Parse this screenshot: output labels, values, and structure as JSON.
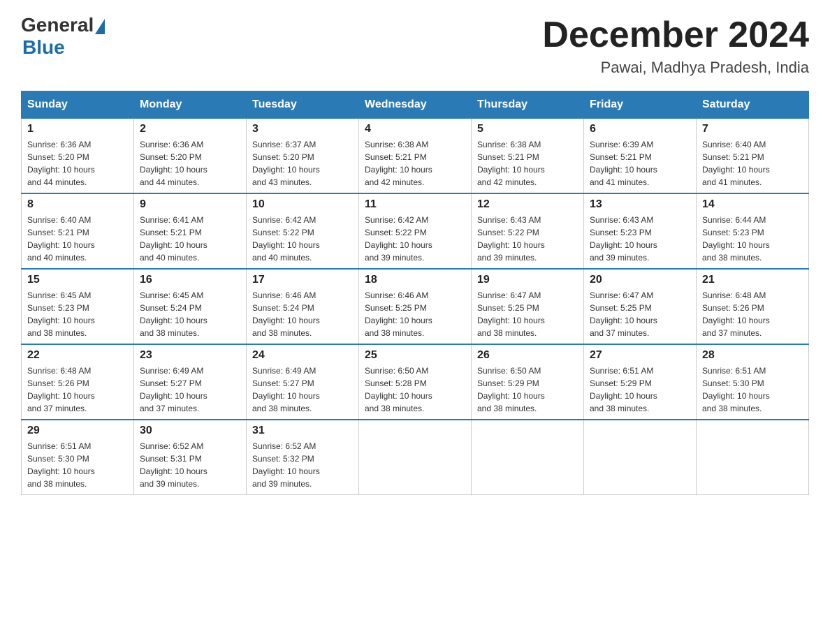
{
  "logo": {
    "general": "General",
    "blue": "Blue"
  },
  "title": "December 2024",
  "location": "Pawai, Madhya Pradesh, India",
  "days_of_week": [
    "Sunday",
    "Monday",
    "Tuesday",
    "Wednesday",
    "Thursday",
    "Friday",
    "Saturday"
  ],
  "weeks": [
    [
      {
        "day": "1",
        "sunrise": "6:36 AM",
        "sunset": "5:20 PM",
        "daylight": "10 hours and 44 minutes."
      },
      {
        "day": "2",
        "sunrise": "6:36 AM",
        "sunset": "5:20 PM",
        "daylight": "10 hours and 44 minutes."
      },
      {
        "day": "3",
        "sunrise": "6:37 AM",
        "sunset": "5:20 PM",
        "daylight": "10 hours and 43 minutes."
      },
      {
        "day": "4",
        "sunrise": "6:38 AM",
        "sunset": "5:21 PM",
        "daylight": "10 hours and 42 minutes."
      },
      {
        "day": "5",
        "sunrise": "6:38 AM",
        "sunset": "5:21 PM",
        "daylight": "10 hours and 42 minutes."
      },
      {
        "day": "6",
        "sunrise": "6:39 AM",
        "sunset": "5:21 PM",
        "daylight": "10 hours and 41 minutes."
      },
      {
        "day": "7",
        "sunrise": "6:40 AM",
        "sunset": "5:21 PM",
        "daylight": "10 hours and 41 minutes."
      }
    ],
    [
      {
        "day": "8",
        "sunrise": "6:40 AM",
        "sunset": "5:21 PM",
        "daylight": "10 hours and 40 minutes."
      },
      {
        "day": "9",
        "sunrise": "6:41 AM",
        "sunset": "5:21 PM",
        "daylight": "10 hours and 40 minutes."
      },
      {
        "day": "10",
        "sunrise": "6:42 AM",
        "sunset": "5:22 PM",
        "daylight": "10 hours and 40 minutes."
      },
      {
        "day": "11",
        "sunrise": "6:42 AM",
        "sunset": "5:22 PM",
        "daylight": "10 hours and 39 minutes."
      },
      {
        "day": "12",
        "sunrise": "6:43 AM",
        "sunset": "5:22 PM",
        "daylight": "10 hours and 39 minutes."
      },
      {
        "day": "13",
        "sunrise": "6:43 AM",
        "sunset": "5:23 PM",
        "daylight": "10 hours and 39 minutes."
      },
      {
        "day": "14",
        "sunrise": "6:44 AM",
        "sunset": "5:23 PM",
        "daylight": "10 hours and 38 minutes."
      }
    ],
    [
      {
        "day": "15",
        "sunrise": "6:45 AM",
        "sunset": "5:23 PM",
        "daylight": "10 hours and 38 minutes."
      },
      {
        "day": "16",
        "sunrise": "6:45 AM",
        "sunset": "5:24 PM",
        "daylight": "10 hours and 38 minutes."
      },
      {
        "day": "17",
        "sunrise": "6:46 AM",
        "sunset": "5:24 PM",
        "daylight": "10 hours and 38 minutes."
      },
      {
        "day": "18",
        "sunrise": "6:46 AM",
        "sunset": "5:25 PM",
        "daylight": "10 hours and 38 minutes."
      },
      {
        "day": "19",
        "sunrise": "6:47 AM",
        "sunset": "5:25 PM",
        "daylight": "10 hours and 38 minutes."
      },
      {
        "day": "20",
        "sunrise": "6:47 AM",
        "sunset": "5:25 PM",
        "daylight": "10 hours and 37 minutes."
      },
      {
        "day": "21",
        "sunrise": "6:48 AM",
        "sunset": "5:26 PM",
        "daylight": "10 hours and 37 minutes."
      }
    ],
    [
      {
        "day": "22",
        "sunrise": "6:48 AM",
        "sunset": "5:26 PM",
        "daylight": "10 hours and 37 minutes."
      },
      {
        "day": "23",
        "sunrise": "6:49 AM",
        "sunset": "5:27 PM",
        "daylight": "10 hours and 37 minutes."
      },
      {
        "day": "24",
        "sunrise": "6:49 AM",
        "sunset": "5:27 PM",
        "daylight": "10 hours and 38 minutes."
      },
      {
        "day": "25",
        "sunrise": "6:50 AM",
        "sunset": "5:28 PM",
        "daylight": "10 hours and 38 minutes."
      },
      {
        "day": "26",
        "sunrise": "6:50 AM",
        "sunset": "5:29 PM",
        "daylight": "10 hours and 38 minutes."
      },
      {
        "day": "27",
        "sunrise": "6:51 AM",
        "sunset": "5:29 PM",
        "daylight": "10 hours and 38 minutes."
      },
      {
        "day": "28",
        "sunrise": "6:51 AM",
        "sunset": "5:30 PM",
        "daylight": "10 hours and 38 minutes."
      }
    ],
    [
      {
        "day": "29",
        "sunrise": "6:51 AM",
        "sunset": "5:30 PM",
        "daylight": "10 hours and 38 minutes."
      },
      {
        "day": "30",
        "sunrise": "6:52 AM",
        "sunset": "5:31 PM",
        "daylight": "10 hours and 39 minutes."
      },
      {
        "day": "31",
        "sunrise": "6:52 AM",
        "sunset": "5:32 PM",
        "daylight": "10 hours and 39 minutes."
      },
      null,
      null,
      null,
      null
    ]
  ],
  "labels": {
    "sunrise": "Sunrise:",
    "sunset": "Sunset:",
    "daylight": "Daylight:"
  }
}
